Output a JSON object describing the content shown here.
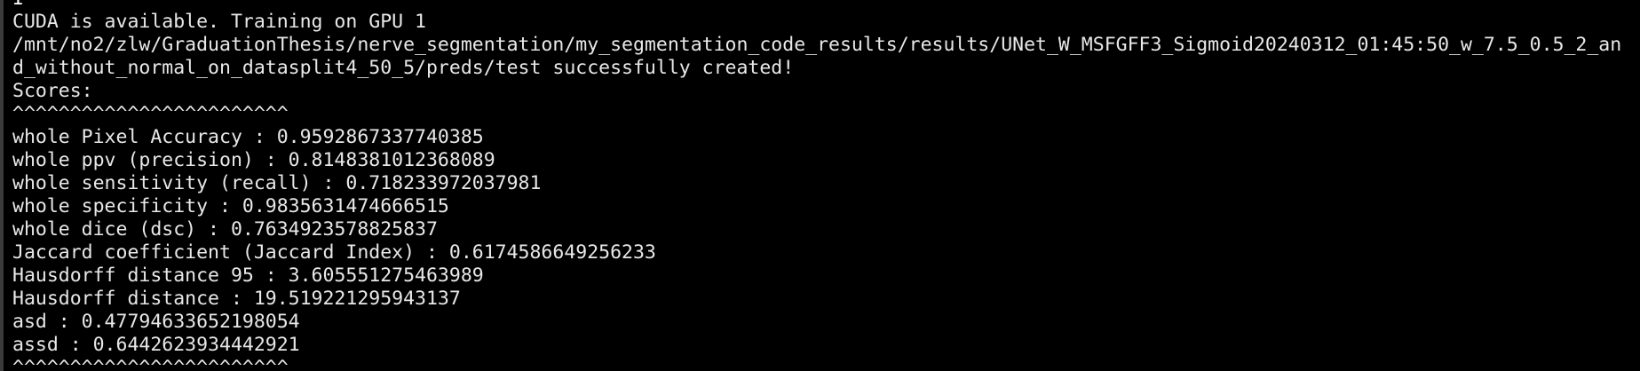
{
  "terminal": {
    "cursor_fragment": "I",
    "lines": [
      "CUDA is available. Training on GPU 1",
      "/mnt/no2/zlw/GraduationThesis/nerve_segmentation/my_segmentation_code_results/results/UNet_W_MSFGFF3_Sigmoid20240312_01:45:50_w_7.5_0.5_2_an",
      "d_without_normal_on_datasplit4_50_5/preds/test successfully created!",
      "Scores:",
      "^^^^^^^^^^^^^^^^^^^^^^^^",
      "whole Pixel Accuracy : 0.9592867337740385",
      "whole ppv (precision) : 0.8148381012368089",
      "whole sensitivity (recall) : 0.718233972037981",
      "whole specificity : 0.9835631474666515",
      "whole dice (dsc) : 0.7634923578825837",
      "Jaccard coefficient (Jaccard Index) : 0.6174586649256233",
      "Hausdorff distance 95 : 3.605551275463989",
      "Hausdorff distance : 19.519221295943137",
      "asd : 0.47794633652198054",
      "assd : 0.6442623934442921",
      "^^^^^^^^^^^^^^^^^^^^^^^^"
    ]
  }
}
